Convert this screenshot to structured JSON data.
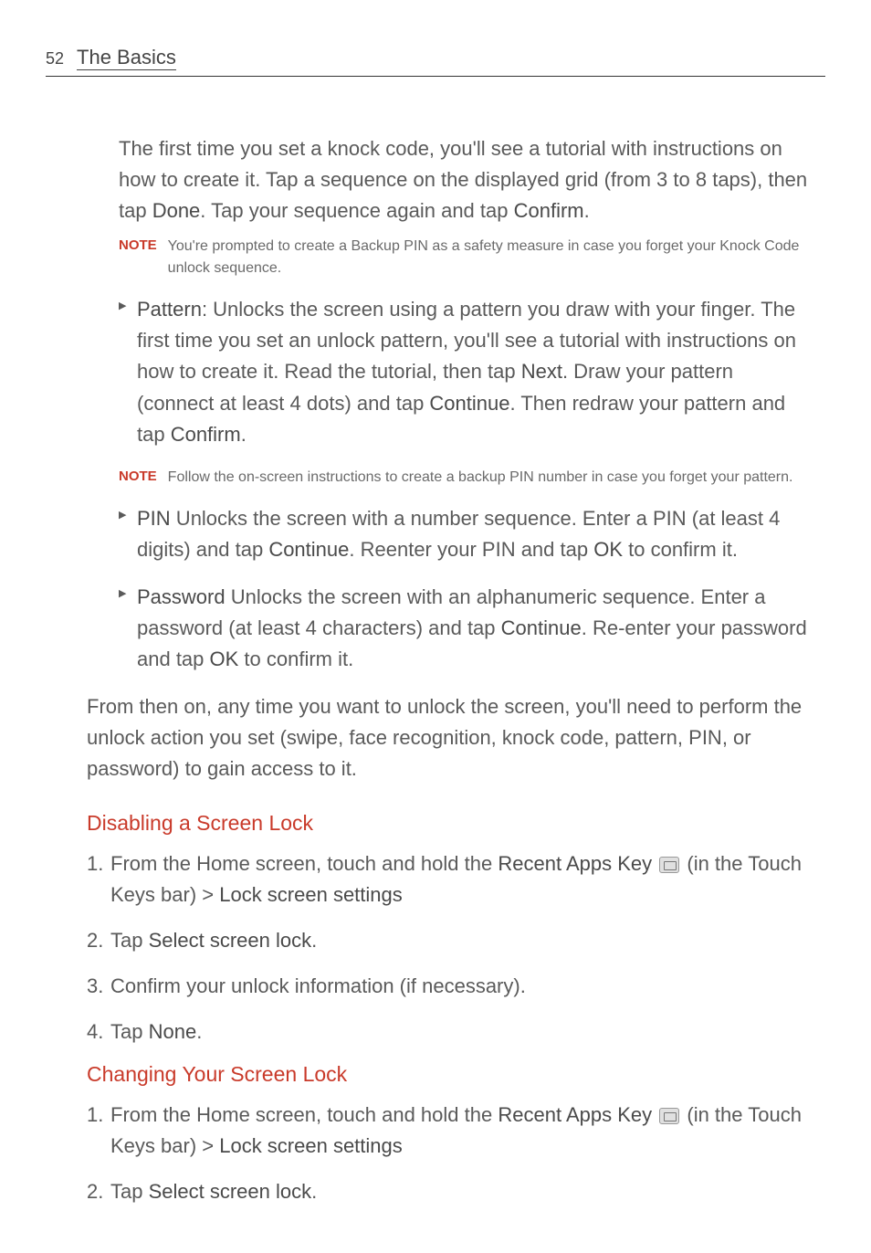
{
  "header": {
    "page_number": "52",
    "title": "The Basics"
  },
  "intro_paragraph": {
    "text_before": " The first time you set a knock code, you'll see a tutorial with instructions on how to create it. Tap a sequence on the displayed grid (from 3 to 8 taps), then tap ",
    "bold1": "Done",
    "mid": ". Tap your sequence again and tap ",
    "bold2": "Confirm",
    "end": "."
  },
  "note1": {
    "label": "NOTE",
    "text": "You're prompted to create a Backup PIN as a safety measure in case you forget your Knock Code unlock sequence."
  },
  "pattern_bullet": {
    "bold1": "Pattern",
    "text1": ": Unlocks the screen using a pattern you draw with your finger. The first time you set an unlock pattern, you'll see a tutorial with instructions on how to create it. Read the tutorial, then tap ",
    "bold2": "Next",
    "text2": ". Draw your pattern (connect at least 4 dots) and tap ",
    "bold3": "Continue",
    "text3": ". Then redraw your pattern and tap ",
    "bold4": "Confirm",
    "text4": "."
  },
  "note2": {
    "label": "NOTE",
    "text": "Follow the on-screen instructions to create a backup PIN number in case you forget your pattern."
  },
  "pin_bullet": {
    "bold1": "PIN",
    "text1": " Unlocks the screen with a number sequence. Enter a PIN (at least 4 digits) and tap ",
    "bold2": "Continue",
    "text2": ". Reenter your PIN and tap ",
    "bold3": "OK",
    "text3": " to confirm it."
  },
  "password_bullet": {
    "bold1": "Password",
    "text1": " Unlocks the screen with an alphanumeric sequence. Enter a password (at least 4 characters) and tap ",
    "bold2": "Continue",
    "text2": ". Re-enter your password and tap ",
    "bold3": "OK",
    "text3": " to confirm it."
  },
  "closing_para": "From then on, any time you want to unlock the screen, you'll need to perform the unlock action you set (swipe, face recognition, knock code, pattern, PIN, or password) to gain access to it.",
  "section1": {
    "heading": "Disabling a Screen Lock",
    "step1": {
      "text1": "From the Home screen, touch and hold the ",
      "bold1": "Recent Apps Key",
      "text2": " (in the Touch Keys bar) > ",
      "bold2": "Lock screen settings"
    },
    "step2": {
      "text1": "Tap ",
      "bold1": "Select screen lock",
      "text2": "."
    },
    "step3": "Confirm your unlock information (if necessary).",
    "step4": {
      "text1": "Tap ",
      "bold1": "None",
      "text2": "."
    }
  },
  "section2": {
    "heading": "Changing Your Screen Lock",
    "step1": {
      "text1": "From the Home screen, touch and hold the ",
      "bold1": "Recent Apps Key",
      "text2": " (in the Touch Keys bar) > ",
      "bold2": "Lock screen settings"
    },
    "step2": {
      "text1": "Tap ",
      "bold1": "Select screen lock",
      "text2": "."
    }
  }
}
